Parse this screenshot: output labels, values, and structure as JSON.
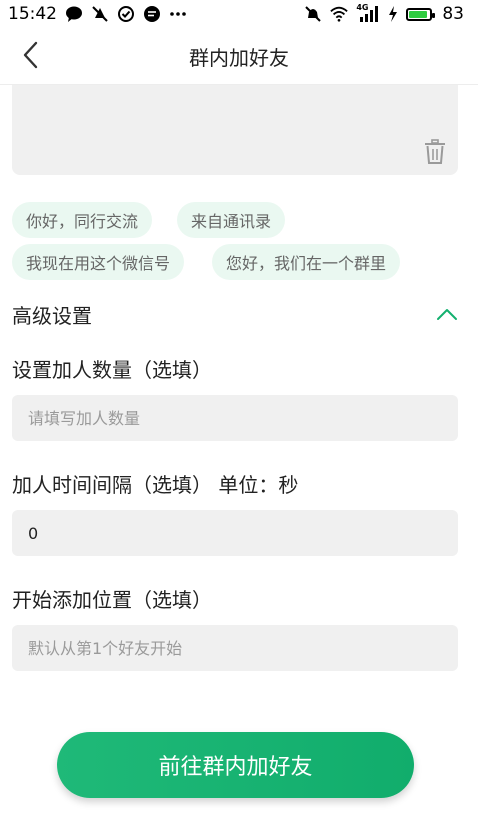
{
  "status_bar": {
    "time": "15:42",
    "network": "4G",
    "battery": "83",
    "left_icons": [
      "chat-bubble-icon",
      "notification-off-icon",
      "check-circle-icon",
      "message-icon",
      "more-icon"
    ],
    "right_icons": [
      "mute-icon",
      "wifi-icon",
      "signal-icon",
      "charging-icon",
      "battery-icon"
    ]
  },
  "header": {
    "title": "群内加好友",
    "back_icon": "chevron-left-icon"
  },
  "message": {
    "delete_icon": "trash-icon"
  },
  "quick_phrases": [
    "你好，同行交流",
    "来自通讯录",
    "我现在用这个微信号",
    "您好，我们在一个群里"
  ],
  "advanced": {
    "title": "高级设置",
    "toggle_icon": "chevron-up-icon"
  },
  "fields": {
    "count": {
      "label": "设置加人数量（选填）",
      "placeholder": "请填写加人数量",
      "value": ""
    },
    "interval": {
      "label": "加人时间间隔（选填） 单位：秒",
      "placeholder": "",
      "value": "0"
    },
    "start": {
      "label": "开始添加位置（选填）",
      "placeholder": "默认从第1个好友开始",
      "value": ""
    }
  },
  "cta": {
    "label": "前往群内加好友"
  },
  "colors": {
    "accent": "#13b06f",
    "chip_bg": "#eaf8f1",
    "field_bg": "#f0f0f0"
  }
}
